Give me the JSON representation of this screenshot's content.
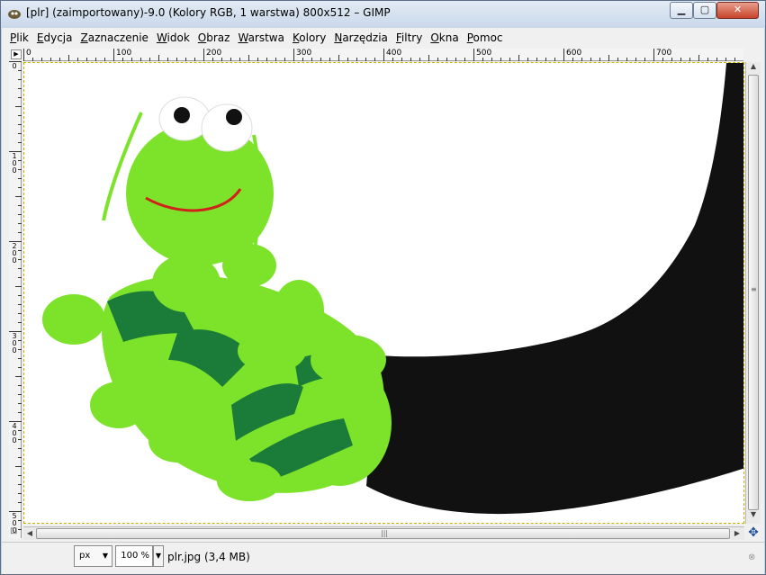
{
  "window": {
    "title": "[plr] (zaimportowany)-9.0 (Kolory RGB, 1 warstwa) 800x512 – GIMP",
    "minimize": "▁",
    "maximize": "▢",
    "close": "✕"
  },
  "menu": [
    "Plik",
    "Edycja",
    "Zaznaczenie",
    "Widok",
    "Obraz",
    "Warstwa",
    "Kolory",
    "Narzędzia",
    "Filtry",
    "Okna",
    "Pomoc"
  ],
  "ruler": {
    "corner": "▶",
    "h_labels": [
      "0",
      "100",
      "200",
      "300",
      "400",
      "500",
      "600",
      "700"
    ],
    "v_labels": [
      "0",
      "100",
      "200",
      "300",
      "400",
      "500"
    ]
  },
  "image": {
    "subject": "green caterpillar hand puppet",
    "colors": {
      "body": "#7de32a",
      "stripe": "#1b7c3a",
      "sleeve": "#111111",
      "mouth": "#d0221b"
    }
  },
  "status": {
    "unit": "px",
    "zoom": "100 %",
    "file": "plr.jpg (3,4 MB)"
  },
  "icons": {
    "navigate": "✥",
    "lock": "⊡",
    "cancel": "⊗",
    "dropdown": "▼"
  }
}
